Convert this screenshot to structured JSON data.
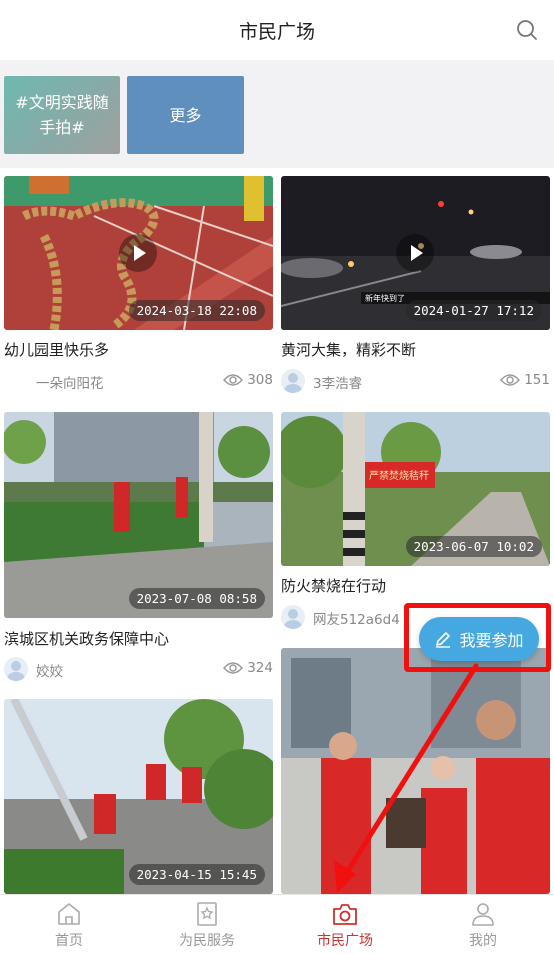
{
  "header": {
    "title": "市民广场",
    "search_icon": "search-icon"
  },
  "tags": [
    {
      "label": "#文明实践随手拍#"
    },
    {
      "label": "更多"
    }
  ],
  "cards": [
    {
      "title": "幼儿园里快乐多",
      "date": "2024-03-18 22:08",
      "author": "一朵向阳花",
      "views": "308",
      "is_video": true
    },
    {
      "title": "黄河大集，精彩不断",
      "date": "2024-01-27 17:12",
      "author": "3李浩睿",
      "views": "151",
      "is_video": true,
      "overlay_text": "新年快到了"
    },
    {
      "title": "滨城区机关政务保障中心",
      "date": "2023-07-08 08:58",
      "author": "姣姣",
      "views": "324"
    },
    {
      "title": "防火禁烧在行动",
      "date": "2023-06-07 10:02",
      "author": "网友512a6d4",
      "banner_text": "严禁焚烧秸秆"
    },
    {
      "title": "",
      "date": "2023-04-15 15:45"
    },
    {
      "title": ""
    }
  ],
  "join_button": {
    "label": "我要参加",
    "icon": "pencil-icon"
  },
  "tabbar": {
    "items": [
      {
        "label": "首页",
        "icon": "home-icon"
      },
      {
        "label": "为民服务",
        "icon": "service-icon"
      },
      {
        "label": "市民广场",
        "icon": "camera-icon",
        "active": true
      },
      {
        "label": "我的",
        "icon": "user-icon"
      }
    ]
  },
  "colors": {
    "accent": "#d0312d",
    "join_button": "#45a8e0",
    "highlight": "#f01010",
    "tag1": "#6fb8b0",
    "tag2": "#5f8fbd"
  }
}
